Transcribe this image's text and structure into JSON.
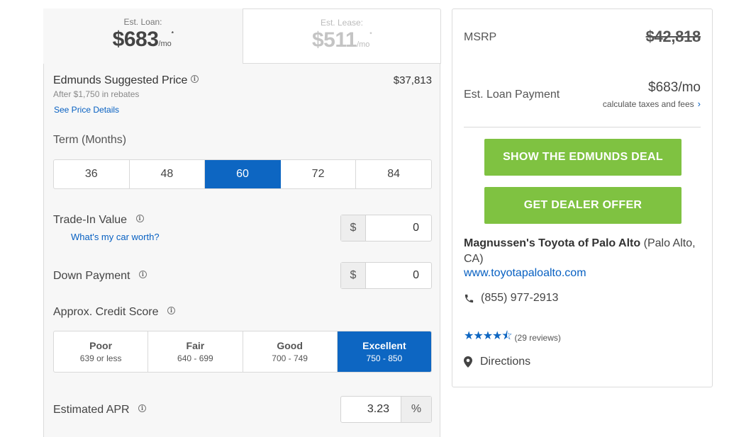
{
  "loan_tab": {
    "label": "Est. Loan:",
    "value": "$683",
    "unit": "/mo",
    "marker": "*"
  },
  "lease_tab": {
    "label": "Est. Lease:",
    "value": "$511",
    "unit": "/mo",
    "marker": "*"
  },
  "suggested_price": {
    "title": "Edmunds Suggested Price",
    "price": "$37,813",
    "rebate_note": "After $1,750 in rebates",
    "details_link": "See Price Details"
  },
  "term": {
    "label": "Term (Months)",
    "options": [
      "36",
      "48",
      "60",
      "72",
      "84"
    ],
    "selected": "60"
  },
  "trade_in": {
    "label": "Trade-In Value",
    "link": "What's my car worth?",
    "prefix": "$",
    "value": "0"
  },
  "down_payment": {
    "label": "Down Payment",
    "prefix": "$",
    "value": "0"
  },
  "credit": {
    "label": "Approx. Credit Score",
    "options": [
      {
        "name": "Poor",
        "range": "639 or less"
      },
      {
        "name": "Fair",
        "range": "640 - 699"
      },
      {
        "name": "Good",
        "range": "700 - 749"
      },
      {
        "name": "Excellent",
        "range": "750 - 850"
      }
    ],
    "selected": "Excellent"
  },
  "apr": {
    "label": "Estimated APR",
    "value": "3.23",
    "suffix": "%"
  },
  "summary": {
    "msrp_label": "MSRP",
    "msrp_value": "$42,818",
    "loan_label": "Est. Loan Payment",
    "loan_value": "$683/mo",
    "calc_link": "calculate taxes and fees"
  },
  "actions": {
    "edmunds_deal": "SHOW THE EDMUNDS DEAL",
    "dealer_offer": "GET DEALER OFFER"
  },
  "dealer": {
    "name": "Magnussen's Toyota of Palo Alto",
    "location": "(Palo Alto, CA)",
    "url": "www.toyotapaloalto.com",
    "phone": "(855) 977-2913",
    "rating": 4.5,
    "reviews": "(29 reviews)",
    "directions": "Directions"
  },
  "colors": {
    "accent_blue": "#0d66c2",
    "link_blue": "#0760c2",
    "cta_green": "#7fc241"
  },
  "icons": {
    "info": "info-icon",
    "phone": "phone-icon",
    "location": "map-pin-icon",
    "chevron": "chevron-right-icon",
    "star": "star-icon"
  }
}
